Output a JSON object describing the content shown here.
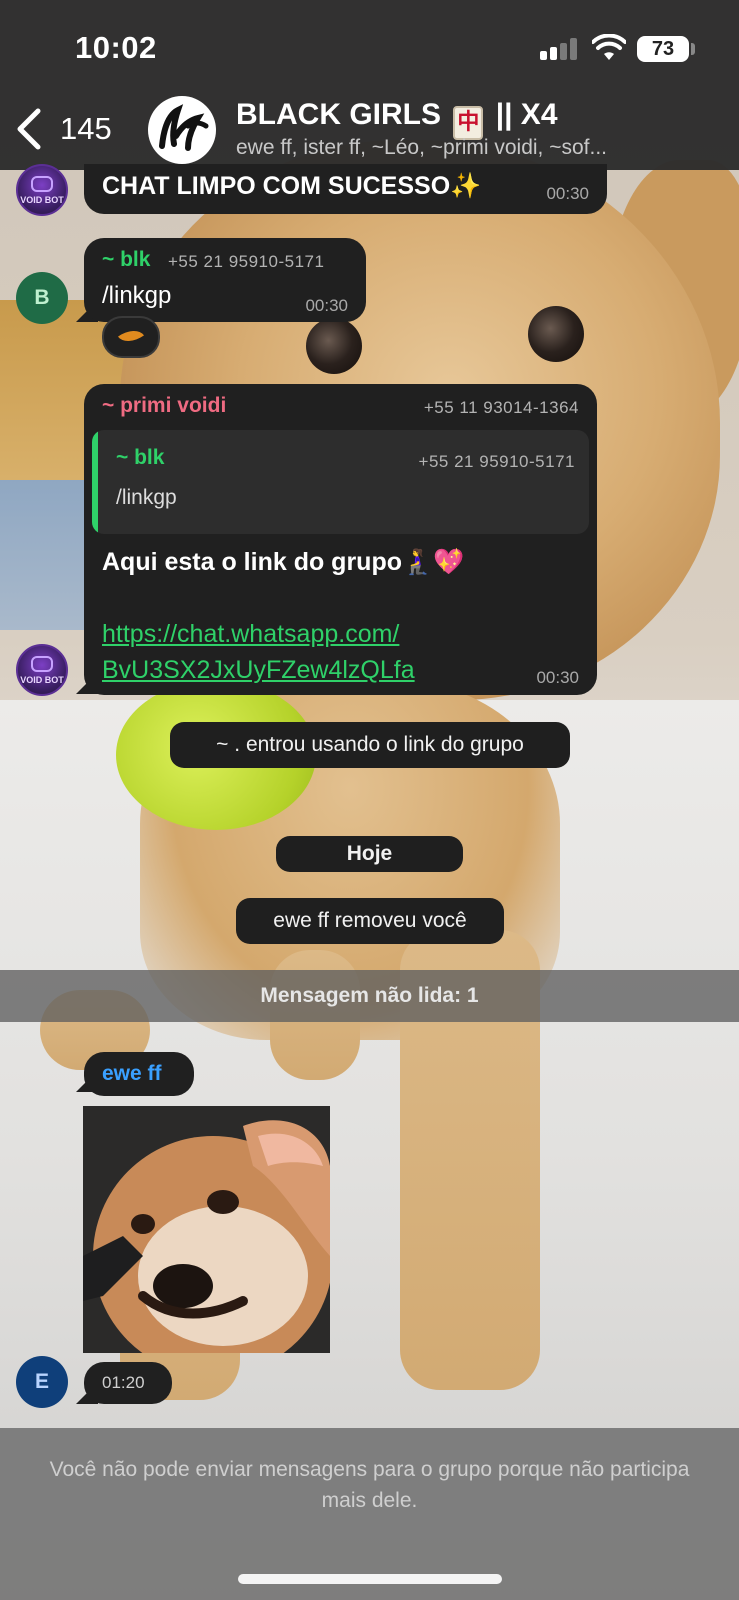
{
  "status_bar": {
    "time": "10:02",
    "battery": "73",
    "battery_level_percent": 73
  },
  "header": {
    "back_count": "145",
    "title_pre": "BLACK GIRLS",
    "title_post": "|| X4",
    "tile_glyph": "中",
    "subtitle": "ewe ff, ister ff, ~Léo, ~primi voidi, ~sof..."
  },
  "messages": {
    "bot1": {
      "text": "CHAT LIMPO COM SUCESSO✨",
      "time": "00:30",
      "avatar_label": "VOID BOT"
    },
    "blk": {
      "sender": "~ blk",
      "phone": "+55 21 95910-5171",
      "text": "/linkgp",
      "time": "00:30",
      "avatar_letter": "B"
    },
    "reaction": {
      "icon": "fallen-leaf-icon"
    },
    "primi": {
      "sender": "~ primi voidi",
      "phone": "+55 11 93014-1364",
      "quote_sender": "~ blk",
      "quote_phone": "+55 21 95910-5171",
      "quote_text": "/linkgp",
      "text": "Aqui esta o link do grupo🧎‍♀️💖",
      "link_line1": "https://chat.whatsapp.com/",
      "link_line2": "BvU3SX2JxUyFZew4lzQLfa",
      "time": "00:30",
      "avatar_label": "VOID BOT"
    },
    "system_joined": "~ . entrou usando o link do grupo",
    "date_chip": "Hoje",
    "system_removed": "ewe ff removeu você",
    "unread": "Mensagem não lida: 1",
    "ewe": {
      "sender": "ewe ff",
      "time": "01:20",
      "avatar_letter": "E"
    }
  },
  "footer": {
    "text": "Você não pode enviar mensagens para o grupo porque não participa mais dele."
  },
  "colors": {
    "bubble": "#202020",
    "green_name": "#2fd169",
    "pink_name": "#ef6b82",
    "blue_name": "#3aa0ff",
    "link": "#2fd169"
  }
}
